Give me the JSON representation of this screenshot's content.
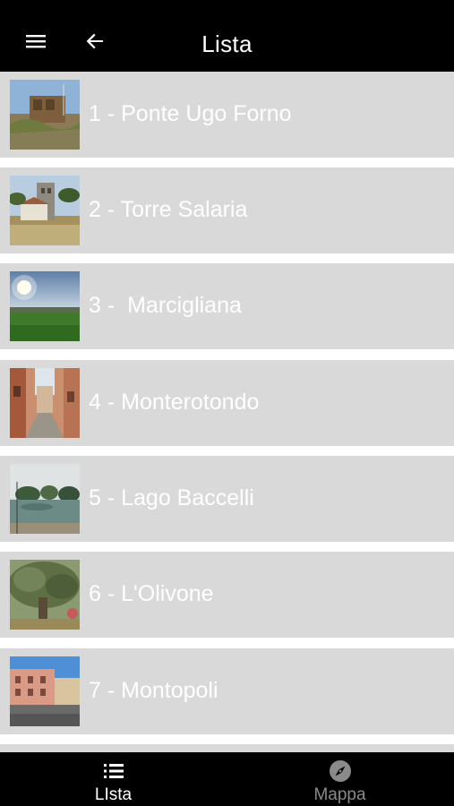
{
  "header": {
    "title": "Lista",
    "menu_icon": "hamburger-menu-icon",
    "back_icon": "arrow-left-icon"
  },
  "list": {
    "items": [
      {
        "label": "1 - Ponte Ugo Forno",
        "thumbnail": "bridge-ruins-photo"
      },
      {
        "label": "2 - Torre Salaria",
        "thumbnail": "stone-tower-photo"
      },
      {
        "label": "3 -  Marcigliana",
        "thumbnail": "green-field-sunset-photo"
      },
      {
        "label": "4 - Monterotondo",
        "thumbnail": "narrow-street-photo"
      },
      {
        "label": "5 - Lago Baccelli",
        "thumbnail": "lake-trees-photo"
      },
      {
        "label": "6 - L'Olivone",
        "thumbnail": "olive-tree-photo"
      },
      {
        "label": "7 - Montopoli",
        "thumbnail": "town-square-photo"
      }
    ]
  },
  "tabs": [
    {
      "label": "LIsta",
      "icon": "list-icon",
      "active": true
    },
    {
      "label": "Mappa",
      "icon": "compass-icon",
      "active": false
    }
  ],
  "colors": {
    "bar_background": "#000000",
    "row_background": "#d9d9d9",
    "text": "#ffffff",
    "inactive_tab": "#8a8a8a"
  }
}
